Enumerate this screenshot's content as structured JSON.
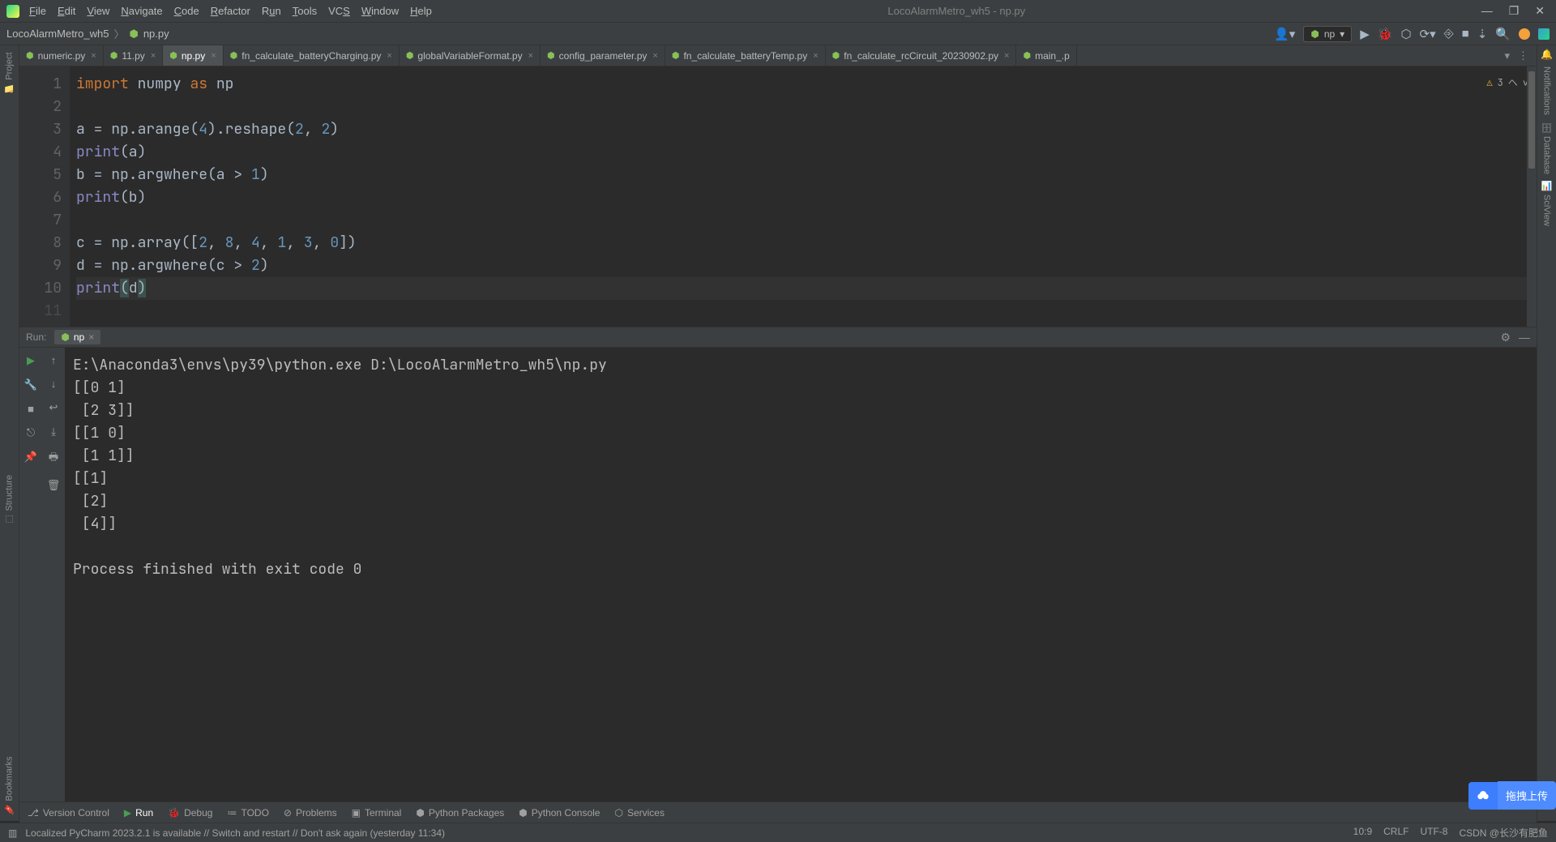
{
  "window": {
    "title": "LocoAlarmMetro_wh5 - np.py"
  },
  "menu": [
    "File",
    "Edit",
    "View",
    "Navigate",
    "Code",
    "Refactor",
    "Run",
    "Tools",
    "VCS",
    "Window",
    "Help"
  ],
  "crumbs": {
    "project": "LocoAlarmMetro_wh5",
    "file": "np.py"
  },
  "runcfg": {
    "label": "np"
  },
  "tabs": [
    {
      "label": "numeric.py",
      "active": false
    },
    {
      "label": "11.py",
      "active": false
    },
    {
      "label": "np.py",
      "active": true
    },
    {
      "label": "fn_calculate_batteryCharging.py",
      "active": false
    },
    {
      "label": "globalVariableFormat.py",
      "active": false
    },
    {
      "label": "config_parameter.py",
      "active": false
    },
    {
      "label": "fn_calculate_batteryTemp.py",
      "active": false
    },
    {
      "label": "fn_calculate_rcCircuit_20230902.py",
      "active": false
    },
    {
      "label": "main_.p",
      "active": false
    }
  ],
  "inspect": {
    "warn_count": "3"
  },
  "gutter": [
    "1",
    "2",
    "3",
    "4",
    "5",
    "6",
    "7",
    "8",
    "9",
    "10",
    "11"
  ],
  "code": {
    "l1_a": "import",
    "l1_b": "numpy",
    "l1_c": "as",
    "l1_d": "np",
    "l3_a": "a = np.arange(",
    "l3_b": "4",
    "l3_c": ").reshape(",
    "l3_d": "2",
    "l3_e": ", ",
    "l3_f": "2",
    "l3_g": ")",
    "l4_a": "print",
    "l4_b": "(a)",
    "l5_a": "b = np.argwhere(a > ",
    "l5_b": "1",
    "l5_c": ")",
    "l6_a": "print",
    "l6_b": "(b)",
    "l8_a": "c = np.array([",
    "l8_b": "2",
    "l8_c": ", ",
    "l8_d": "8",
    "l8_e": ", ",
    "l8_f": "4",
    "l8_g": ", ",
    "l8_h": "1",
    "l8_i": ", ",
    "l8_j": "3",
    "l8_k": ", ",
    "l8_l": "0",
    "l8_m": "])",
    "l9_a": "d = np.argwhere(c > ",
    "l9_b": "2",
    "l9_c": ")",
    "l10_a": "print",
    "l10_b": "(",
    "l10_c": "d",
    "l10_d": ")"
  },
  "run": {
    "label": "Run:",
    "tab": "np",
    "output": "E:\\Anaconda3\\envs\\py39\\python.exe D:\\LocoAlarmMetro_wh5\\np.py\n[[0 1]\n [2 3]]\n[[1 0]\n [1 1]]\n[[1]\n [2]\n [4]]\n\nProcess finished with exit code 0"
  },
  "bottom": {
    "vcs": "Version Control",
    "run": "Run",
    "debug": "Debug",
    "todo": "TODO",
    "problems": "Problems",
    "terminal": "Terminal",
    "pkg": "Python Packages",
    "console": "Python Console",
    "services": "Services"
  },
  "leftTools": {
    "project": "Project",
    "structure": "Structure",
    "bookmarks": "Bookmarks"
  },
  "rightTools": {
    "notifications": "Notifications",
    "database": "Database",
    "sciview": "SciView"
  },
  "status": {
    "msg": "Localized PyCharm 2023.2.1 is available // Switch and restart // Don't ask again (yesterday 11:34)",
    "pos": "10:9",
    "crlf": "CRLF",
    "enc": "UTF-8",
    "watermark": "CSDN @长沙有肥鱼"
  },
  "float": {
    "text": "拖拽上传"
  }
}
